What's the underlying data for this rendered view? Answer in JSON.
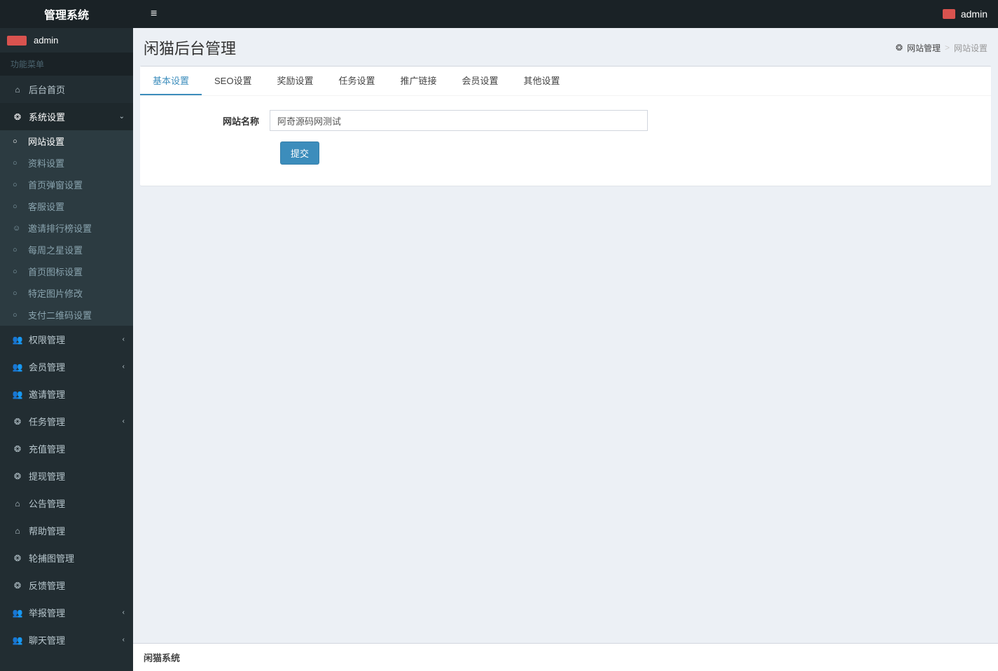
{
  "header": {
    "logo": "管理系统",
    "username": "admin"
  },
  "sidebar": {
    "user_panel_name": "admin",
    "section_label": "功能菜单",
    "items": [
      {
        "label": "后台首页",
        "icon": "home",
        "type": "link"
      },
      {
        "label": "系统设置",
        "icon": "dashboard",
        "type": "tree",
        "open": true,
        "caret": "down",
        "children": [
          {
            "label": "网站设置",
            "icon": "circle",
            "active": true
          },
          {
            "label": "资料设置",
            "icon": "circle"
          },
          {
            "label": "首页弹窗设置",
            "icon": "circle"
          },
          {
            "label": "客服设置",
            "icon": "circle"
          },
          {
            "label": "邀请排行榜设置",
            "icon": "user"
          },
          {
            "label": "每周之星设置",
            "icon": "circle"
          },
          {
            "label": "首页图标设置",
            "icon": "circle"
          },
          {
            "label": "特定图片修改",
            "icon": "circle"
          },
          {
            "label": "支付二维码设置",
            "icon": "circle"
          }
        ]
      },
      {
        "label": "权限管理",
        "icon": "users",
        "type": "tree",
        "caret": "left"
      },
      {
        "label": "会员管理",
        "icon": "users",
        "type": "tree",
        "caret": "left"
      },
      {
        "label": "邀请管理",
        "icon": "users",
        "type": "link"
      },
      {
        "label": "任务管理",
        "icon": "dashboard",
        "type": "tree",
        "caret": "left"
      },
      {
        "label": "充值管理",
        "icon": "dashboard",
        "type": "link"
      },
      {
        "label": "提现管理",
        "icon": "dashboard",
        "type": "link"
      },
      {
        "label": "公告管理",
        "icon": "home",
        "type": "link"
      },
      {
        "label": "帮助管理",
        "icon": "home",
        "type": "link"
      },
      {
        "label": "轮捕图管理",
        "icon": "dashboard",
        "type": "link"
      },
      {
        "label": "反馈管理",
        "icon": "dashboard",
        "type": "link"
      },
      {
        "label": "举报管理",
        "icon": "users",
        "type": "tree",
        "caret": "left"
      },
      {
        "label": "聊天管理",
        "icon": "users",
        "type": "tree",
        "caret": "left"
      }
    ]
  },
  "content": {
    "title": "闲猫后台管理",
    "breadcrumb": {
      "root": "网站管理",
      "current": "网站设置"
    },
    "tabs": [
      {
        "label": "基本设置",
        "active": true
      },
      {
        "label": "SEO设置"
      },
      {
        "label": "奖励设置"
      },
      {
        "label": "任务设置"
      },
      {
        "label": "推广链接"
      },
      {
        "label": "会员设置"
      },
      {
        "label": "其他设置"
      }
    ],
    "form": {
      "site_name_label": "网站名称",
      "site_name_value": "阿奇源码网测试",
      "submit_label": "提交"
    }
  },
  "footer": {
    "text": "闲猫系统"
  },
  "icons": {
    "home": "⌂",
    "dashboard": "❂",
    "users": "👥",
    "user": "☺",
    "circle": "○",
    "caret_left": "‹",
    "caret_down": "⌄",
    "dash_bc": "❂"
  }
}
